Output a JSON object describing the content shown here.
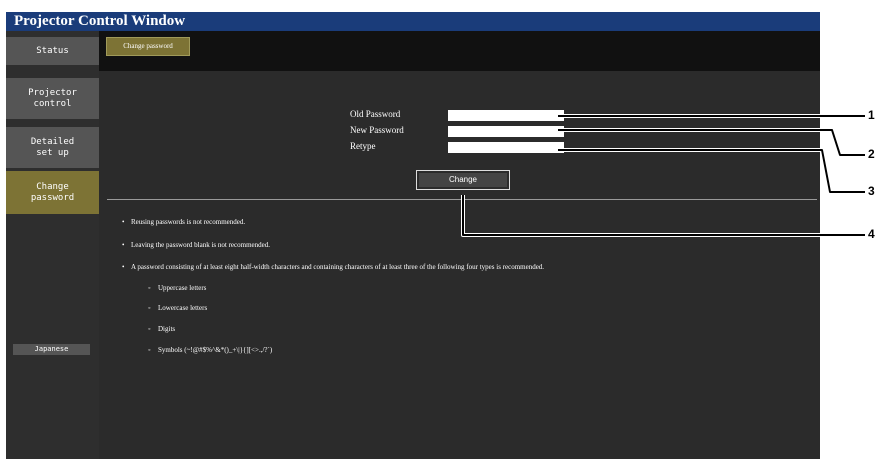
{
  "window": {
    "title": "Projector Control Window"
  },
  "sidebar": {
    "items": [
      {
        "label": "Status"
      },
      {
        "label": "Projector\ncontrol"
      },
      {
        "label": "Detailed\nset up"
      },
      {
        "label": "Change\npassword"
      }
    ],
    "language_button": "Japanese"
  },
  "topbar": {
    "tab_label": "Change password"
  },
  "form": {
    "old_label": "Old Password",
    "new_label": "New Password",
    "retype_label": "Retype",
    "old_value": "",
    "new_value": "",
    "retype_value": "",
    "change_button": "Change"
  },
  "notes": {
    "items": [
      "Reusing passwords is not recommended.",
      "Leaving the password blank is not recommended.",
      "A password consisting of at least eight half-width characters and containing characters of at least three of the following four types is recommended."
    ],
    "subitems": [
      "Uppercase letters",
      "Lowercase letters",
      "Digits",
      "Symbols (~!@#$%^&*()_+\\|}{][<>.,/?`)"
    ]
  },
  "callouts": [
    "1",
    "2",
    "3",
    "4"
  ],
  "colors": {
    "titlebar": "#1a3c7a",
    "active": "#7d7335",
    "background": "#2b2b2b"
  }
}
